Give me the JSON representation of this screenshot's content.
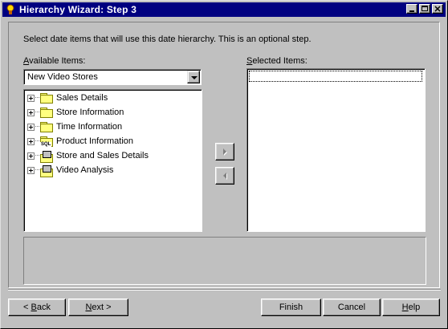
{
  "window": {
    "title": "Hierarchy Wizard: Step 3"
  },
  "instruction": "Select date items that will use this date hierarchy. This is an optional step.",
  "available": {
    "label_key": "A",
    "label_rest": "vailable Items:",
    "selected_value": "New Video Stores",
    "items": [
      {
        "label": "Sales Details",
        "icon": "folder-icon"
      },
      {
        "label": "Store Information",
        "icon": "folder-icon"
      },
      {
        "label": "Time Information",
        "icon": "folder-icon"
      },
      {
        "label": "Product Information",
        "icon": "sql-folder-icon"
      },
      {
        "label": "Store and Sales Details",
        "icon": "multi-folder-icon"
      },
      {
        "label": "Video Analysis",
        "icon": "multi-folder-icon"
      }
    ]
  },
  "selected": {
    "label_key": "S",
    "label_rest": "elected Items:"
  },
  "buttons": {
    "back_prefix": "< ",
    "back_key": "B",
    "back_rest": "ack",
    "next_key": "N",
    "next_rest": "ext >",
    "finish": "Finish",
    "cancel": "Cancel",
    "help_key": "H",
    "help_rest": "elp"
  },
  "colors": {
    "titlebar": "#000080",
    "face": "#c0c0c0"
  }
}
